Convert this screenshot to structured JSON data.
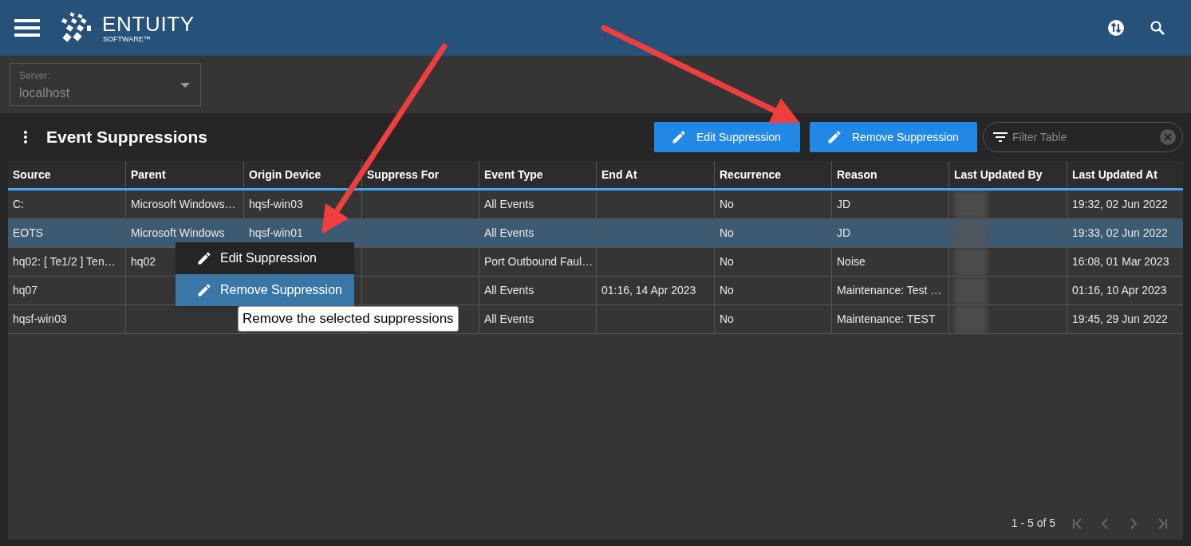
{
  "header": {
    "logo_name": "ENTUITY",
    "logo_sub": "SOFTWARE™"
  },
  "server": {
    "label": "Server:",
    "value": "localhost"
  },
  "panel": {
    "title": "Event Suppressions",
    "buttons": [
      "Edit Suppression",
      "Remove Suppression"
    ],
    "filter": {
      "placeholder": "Filter Table"
    }
  },
  "table": {
    "columns": [
      "Source",
      "Parent",
      "Origin Device",
      "Suppress For",
      "Event Type",
      "End At",
      "Recurrence",
      "Reason",
      "Last Updated By",
      "Last Updated At"
    ],
    "rows": [
      {
        "selected": false,
        "cells": [
          "C:",
          "Microsoft Windows…",
          "hqsf-win03",
          "",
          "All Events",
          "",
          "No",
          "JD",
          "",
          "19:32, 02 Jun 2022"
        ]
      },
      {
        "selected": true,
        "cells": [
          "EOTS",
          "Microsoft Windows",
          "hqsf-win01",
          "",
          "All Events",
          "",
          "No",
          "JD",
          "",
          "19:33, 02 Jun 2022"
        ]
      },
      {
        "selected": false,
        "cells": [
          "hq02: [ Te1/2 ] Ten…",
          "hq02",
          "",
          "",
          "Port Outbound Faul…",
          "",
          "No",
          "Noise",
          "",
          "16:08, 01 Mar 2023"
        ]
      },
      {
        "selected": false,
        "cells": [
          "hq07",
          "",
          "",
          "",
          "All Events",
          "01:16, 14 Apr 2023",
          "No",
          "Maintenance: Test …",
          "",
          "01:16, 10 Apr 2023"
        ]
      },
      {
        "selected": false,
        "cells": [
          "hqsf-win03",
          "",
          "",
          "",
          "All Events",
          "",
          "No",
          "Maintenance: TEST",
          "",
          "19:45, 29 Jun 2022"
        ]
      }
    ]
  },
  "pagination": {
    "range": "1 - 5 of 5"
  },
  "context_menu": {
    "items": [
      {
        "label": "Edit Suppression",
        "selected": false
      },
      {
        "label": "Remove Suppression",
        "selected": true
      }
    ]
  },
  "tooltip": "Remove the selected suppressions"
}
